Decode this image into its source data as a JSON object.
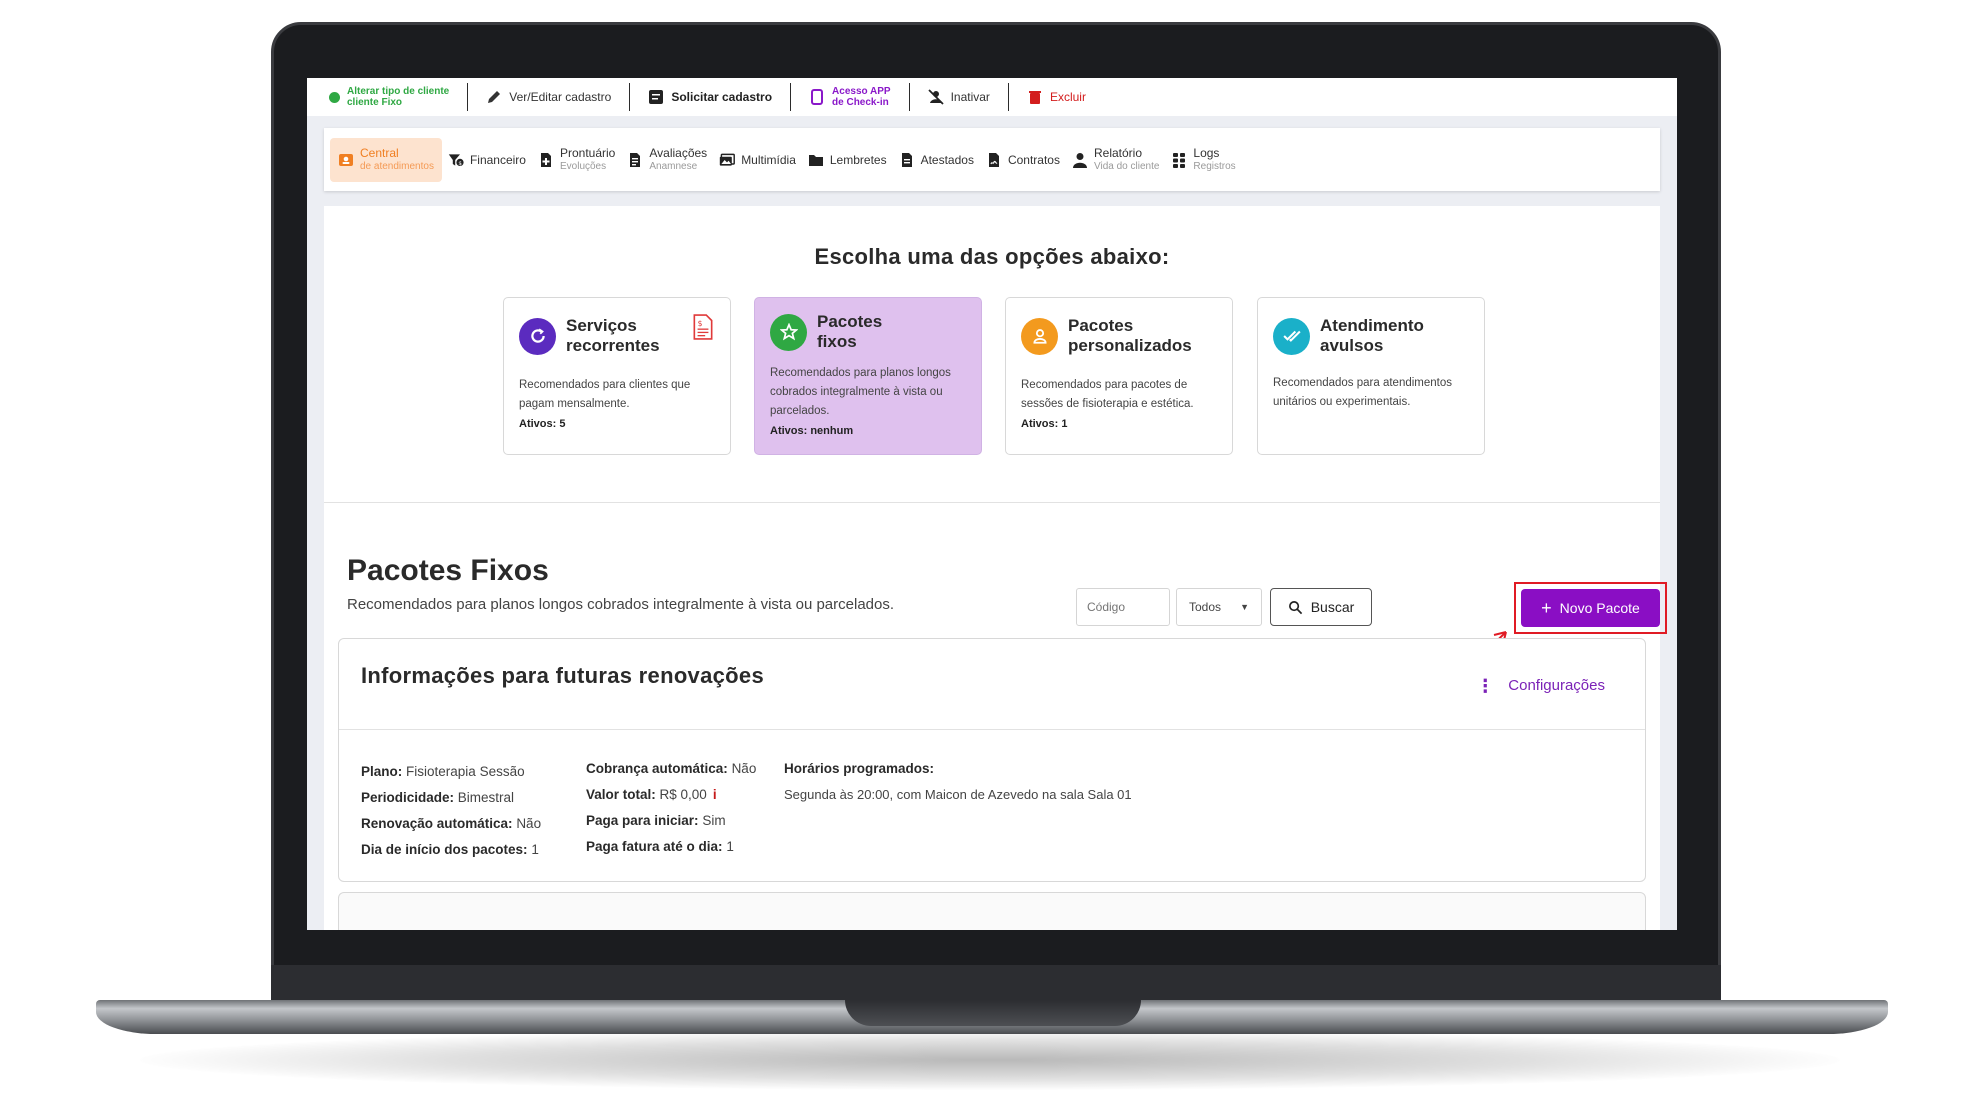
{
  "actions": {
    "client_type_line1": "Alterar tipo de cliente",
    "client_type_line2": "cliente Fixo",
    "view_edit": "Ver/Editar cadastro",
    "request_register": "Solicitar cadastro",
    "app_line1": "Acesso APP",
    "app_line2": "de Check-in",
    "deactivate": "Inativar",
    "delete": "Excluir"
  },
  "nav": {
    "tabs": [
      {
        "label": "Central",
        "sub": "de atendimentos",
        "icon": "user-card-icon"
      },
      {
        "label": "Financeiro",
        "sub": "",
        "icon": "funnel-money-icon"
      },
      {
        "label": "Prontuário",
        "sub": "Evoluções",
        "icon": "file-plus-icon"
      },
      {
        "label": "Avaliações",
        "sub": "Anamnese",
        "icon": "file-list-icon"
      },
      {
        "label": "Multimídia",
        "sub": "",
        "icon": "images-icon"
      },
      {
        "label": "Lembretes",
        "sub": "",
        "icon": "folder-icon"
      },
      {
        "label": "Atestados",
        "sub": "",
        "icon": "document-icon"
      },
      {
        "label": "Contratos",
        "sub": "",
        "icon": "contract-icon"
      },
      {
        "label": "Relatório",
        "sub": "Vida do cliente",
        "icon": "person-icon"
      },
      {
        "label": "Logs",
        "sub": "Registros",
        "icon": "grid-icon"
      }
    ]
  },
  "options": {
    "title": "Escolha uma das opções abaixo:",
    "cards": [
      {
        "title_1": "Serviços",
        "title_2": "recorrentes",
        "desc": "Recomendados para clientes que pagam mensalmente.",
        "active": "Ativos: 5",
        "color": "#5b2bbf"
      },
      {
        "title_1": "Pacotes",
        "title_2": "fixos",
        "desc": "Recomendados para planos longos cobrados integralmente à vista ou parcelados.",
        "active": "Ativos: nenhum",
        "color": "#2fa843"
      },
      {
        "title_1": "Pacotes",
        "title_2": "personalizados",
        "desc": "Recomendados para pacotes de sessões de fisioterapia e estética.",
        "active": "Ativos: 1",
        "color": "#f39a1e"
      },
      {
        "title_1": "Atendimento",
        "title_2": "avulsos",
        "desc": "Recomendados para atendimentos unitários ou experimentais.",
        "active": "",
        "color": "#1ab0c9"
      }
    ]
  },
  "section": {
    "title": "Pacotes Fixos",
    "subtitle": "Recomendados para planos longos cobrados integralmente à vista ou parcelados.",
    "code_placeholder": "Código",
    "filter_value": "Todos",
    "search_label": "Buscar",
    "new_label": "Novo Pacote"
  },
  "info": {
    "title": "Informações para futuras renovações",
    "config_label": "Configurações",
    "plan_label": "Plano:",
    "plan_value": "Fisioterapia Sessão",
    "period_label": "Periodicidade:",
    "period_value": "Bimestral",
    "renew_label": "Renovação automática:",
    "renew_value": "Não",
    "start_label": "Dia de início dos pacotes:",
    "start_value": "1",
    "autocharge_label": "Cobrança automática:",
    "autocharge_value": "Não",
    "total_label": "Valor total:",
    "total_value": "R$ 0,00",
    "paid_label": "Paga para iniciar:",
    "paid_value": "Sim",
    "due_label": "Paga fatura até o dia:",
    "due_value": "1",
    "schedule_label": "Horários programados:",
    "schedule_value": "Segunda às 20:00, com Maicon de Azevedo na sala Sala 01"
  },
  "colors": {
    "accent_purple": "#8a0ec4",
    "active_tab_orange": "#f07f22",
    "highlight_red": "#e01b24"
  }
}
